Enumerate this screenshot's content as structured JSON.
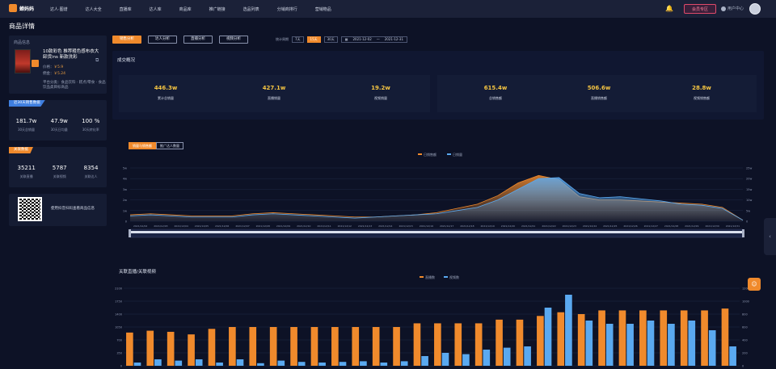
{
  "app": {
    "logo_text": "蝉妈妈"
  },
  "nav": [
    "达人·图谱",
    "达人大全",
    "直播库",
    "达人库",
    "商品库",
    "推广链接",
    "选品列表",
    "分销商排行",
    "营销物品"
  ],
  "header": {
    "member_label": "会员专区",
    "user_label": "用户中心"
  },
  "page": {
    "title": "商品详情"
  },
  "product": {
    "card_label": "商品信息",
    "name": "10款彩色 推荐粗色感布衣大卸货ins 新款洗彩",
    "price_label": "价格：",
    "price": "￥5.9",
    "commission_label": "佣金：",
    "commission": "￥5.24",
    "note": "平台分类：食品饮料 · 糕点/零食 · 食品饮品类目标商品"
  },
  "sales_stats": {
    "tag": "近30天销售数据",
    "items": [
      {
        "value": "181.7w",
        "label": "30天总销量"
      },
      {
        "value": "47.9w",
        "label": "30天日均量"
      },
      {
        "value": "100 %",
        "label": "30天转化率"
      }
    ]
  },
  "link_stats": {
    "tag": "关联数据",
    "items": [
      {
        "value": "35211",
        "label": "关联直播"
      },
      {
        "value": "5787",
        "label": "关联视频"
      },
      {
        "value": "8354",
        "label": "关联达人"
      }
    ]
  },
  "qr": {
    "text": "使用抖音扫码查看商品信息"
  },
  "tabs": [
    "销售分析",
    "达人分析",
    "直播分析",
    "视频分析"
  ],
  "filters": {
    "label": "统计周期",
    "options": [
      "7天",
      "15天",
      "30天"
    ],
    "date_from": "2021-12-02",
    "date_to": "2021-12-31"
  },
  "overview": {
    "title": "成交概况",
    "items": [
      {
        "value": "446.3w",
        "label": "累计总销量"
      },
      {
        "value": "427.1w",
        "label": "直播销量"
      },
      {
        "value": "19.2w",
        "label": "视频销量"
      },
      {
        "value": "615.4w",
        "label": "总销售额"
      },
      {
        "value": "506.6w",
        "label": "直播销售额"
      },
      {
        "value": "28.8w",
        "label": "视频销售额"
      }
    ]
  },
  "trend_tabs": [
    "销量与销售额",
    "推广达人数量"
  ],
  "bars": {
    "title": "关联直播/关联视频"
  },
  "chart_data": [
    {
      "type": "area",
      "title": "",
      "legend_position": "top",
      "series": [
        {
          "name": "日销售额",
          "color": "#f08a2c",
          "values": [
            0.6,
            0.7,
            0.6,
            0.5,
            0.5,
            0.5,
            0.7,
            0.8,
            0.7,
            0.6,
            0.5,
            0.4,
            0.4,
            0.5,
            0.6,
            0.8,
            1.2,
            1.6,
            2.4,
            3.6,
            4.3,
            3.9,
            2.3,
            2.0,
            2.0,
            1.9,
            1.8,
            1.7,
            1.6,
            1.3,
            0.1
          ]
        },
        {
          "name": "日销量",
          "color": "#5aa9f0",
          "values": [
            0.5,
            0.6,
            0.5,
            0.4,
            0.4,
            0.4,
            0.6,
            0.7,
            0.6,
            0.5,
            0.4,
            0.3,
            0.4,
            0.5,
            0.6,
            0.7,
            1.0,
            1.3,
            2.0,
            3.0,
            4.0,
            4.1,
            2.6,
            2.2,
            2.3,
            2.1,
            1.9,
            1.6,
            1.5,
            1.2,
            0.1
          ]
        }
      ],
      "yaxis_left": [
        "0",
        "1w",
        "2w",
        "3w",
        "4w",
        "5w"
      ],
      "yaxis_right": [
        "0",
        "5w",
        "10w",
        "15w",
        "20w",
        "25w"
      ],
      "x": [
        "2021/12/02",
        "2021/12/03",
        "2021/12/04",
        "2021/12/05",
        "2021/12/06",
        "2021/12/07",
        "2021/12/08",
        "2021/12/09",
        "2021/12/10",
        "2021/12/11",
        "2021/12/12",
        "2021/12/13",
        "2021/12/14",
        "2021/12/15",
        "2021/12/16",
        "2021/12/17",
        "2021/12/18",
        "2021/12/19",
        "2021/12/20",
        "2021/12/21",
        "2021/12/22",
        "2021/12/23",
        "2021/12/24",
        "2021/12/25",
        "2021/12/26",
        "2021/12/27",
        "2021/12/28",
        "2021/12/29",
        "2021/12/30",
        "2021/12/31"
      ]
    },
    {
      "type": "bar",
      "title": "",
      "legend_position": "top",
      "series": [
        {
          "name": "直播数",
          "color": "#f08a2c",
          "values": [
            900,
            950,
            920,
            850,
            1000,
            1050,
            1050,
            1050,
            1050,
            1050,
            1050,
            1050,
            1050,
            1050,
            1150,
            1150,
            1150,
            1150,
            1250,
            1250,
            1350,
            1450,
            1400,
            1500,
            1500,
            1500,
            1500,
            1500,
            1500,
            1550
          ]
        },
        {
          "name": "视频数",
          "color": "#5aa9f0",
          "values": [
            50,
            100,
            80,
            100,
            50,
            100,
            40,
            80,
            60,
            50,
            60,
            70,
            50,
            70,
            150,
            200,
            180,
            250,
            280,
            300,
            900,
            1100,
            700,
            650,
            650,
            700,
            650,
            700,
            550,
            300
          ]
        }
      ],
      "yaxis_left": [
        "0",
        "350",
        "700",
        "1050",
        "1400",
        "1750",
        "2100"
      ],
      "yaxis_right": [
        "0",
        "200",
        "400",
        "600",
        "800",
        "1000",
        "1200"
      ]
    }
  ]
}
